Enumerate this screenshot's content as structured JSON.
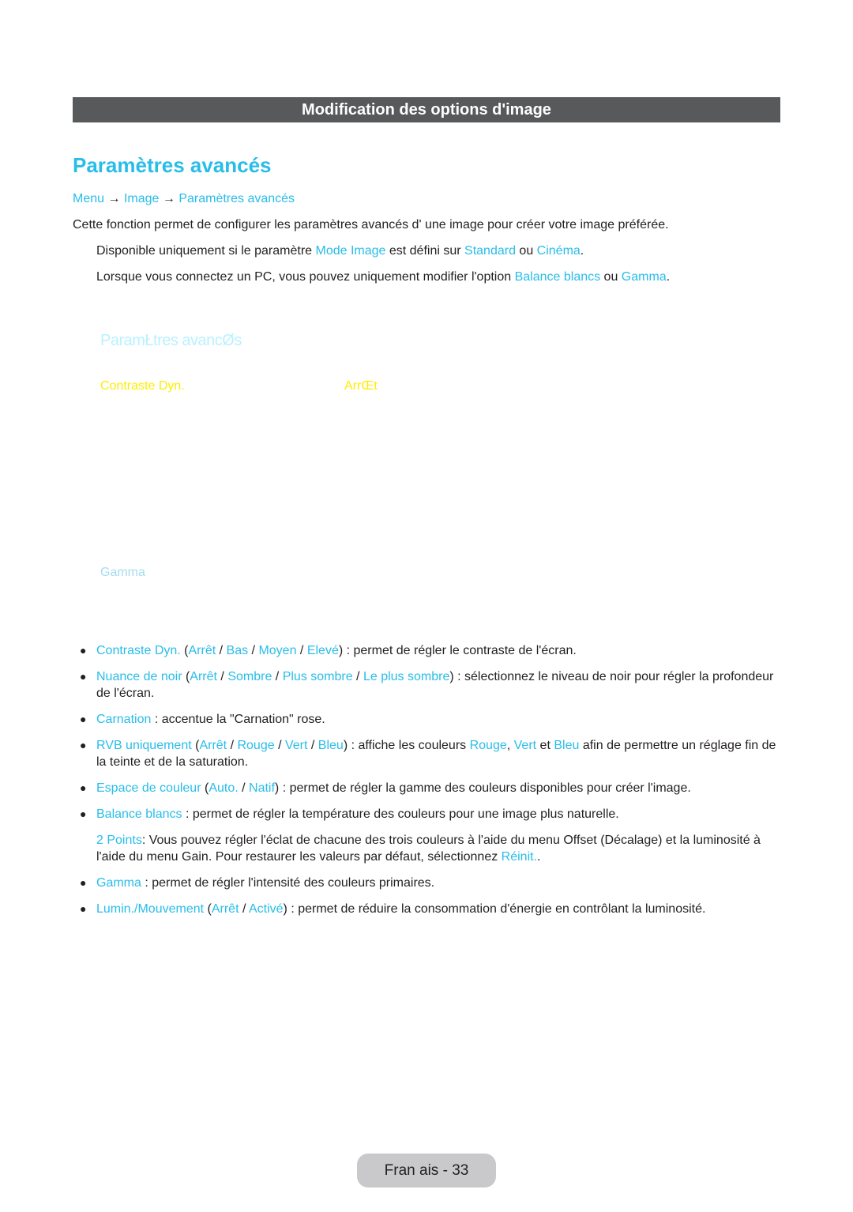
{
  "section_header": "Modification des options d'image",
  "page_title": "Paramètres avancés",
  "breadcrumb": {
    "items": [
      "Menu",
      "Image",
      "Paramètres avancés"
    ],
    "separator": "→"
  },
  "intro": "Cette fonction permet de configurer les paramètres avancés d' une image pour créer votre image préférée.",
  "notes": [
    {
      "parts": [
        "Disponible uniquement si le paramètre ",
        "Mode Image",
        " est défini sur ",
        "Standard",
        " ou ",
        "Cinéma",
        "."
      ]
    },
    {
      "parts": [
        "Lorsque vous connectez un PC, vous pouvez uniquement modifier l'option ",
        "Balance blancs",
        " ou ",
        "Gamma",
        "."
      ]
    }
  ],
  "osd_menu": {
    "title": "ParamŁtres avancØs",
    "items": [
      {
        "label": "Contraste Dyn.",
        "value": "ArrŒt"
      },
      {
        "label": "Gamma",
        "value": ""
      }
    ]
  },
  "bullets": [
    {
      "parts": [
        "Contraste Dyn.",
        " (",
        "Arrêt",
        " / ",
        "Bas",
        " / ",
        "Moyen",
        " / ",
        "Elevé",
        ") : permet de régler le contraste de l'écran."
      ]
    },
    {
      "parts": [
        "Nuance de noir",
        " (",
        "Arrêt",
        " / ",
        "Sombre",
        " / ",
        "Plus sombre",
        " / ",
        "Le plus sombre",
        ") : sélectionnez le niveau de noir pour régler la profondeur de l'écran."
      ]
    },
    {
      "parts": [
        "Carnation",
        " : accentue la \"Carnation\" rose."
      ]
    },
    {
      "parts": [
        "RVB uniquement",
        " (",
        "Arrêt",
        " / ",
        "Rouge",
        " / ",
        "Vert",
        " / ",
        "Bleu",
        ") : affiche les couleurs ",
        "Rouge",
        ", ",
        "Vert",
        " et ",
        "Bleu",
        " afin de permettre un réglage fin de la teinte et de la saturation."
      ]
    },
    {
      "parts": [
        "Espace de couleur",
        " (",
        "Auto.",
        " / ",
        "Natif",
        ") : permet de régler la gamme des couleurs disponibles pour créer l'image."
      ]
    },
    {
      "parts": [
        "Balance blancs",
        " : permet de régler la température des couleurs pour une image plus naturelle."
      ]
    },
    {
      "parts": [
        "2 Points",
        ": Vous pouvez régler l'éclat de chacune des trois couleurs à l'aide du menu Offset (Décalage) et la luminosité à l'aide du menu Gain. Pour restaurer les valeurs par défaut, sélectionnez ",
        "Réinit.",
        "."
      ]
    },
    {
      "parts": [
        "Gamma",
        " : permet de régler l'intensité des couleurs primaires."
      ]
    },
    {
      "parts": [
        "Lumin./Mouvement",
        " (",
        "Arrêt",
        " / ",
        "Activé",
        ") : permet de réduire la consommation d'énergie en contrôlant la luminosité."
      ]
    }
  ],
  "footer": {
    "page_label": "Fran ais - 33"
  },
  "colors": {
    "accent": "#28bde9",
    "header_bar": "#58595b",
    "osd_title": "#b9f1ff",
    "osd_selected": "#ffee00",
    "osd_item": "#a6dcef",
    "footer_pill": "#c9c9cb"
  }
}
